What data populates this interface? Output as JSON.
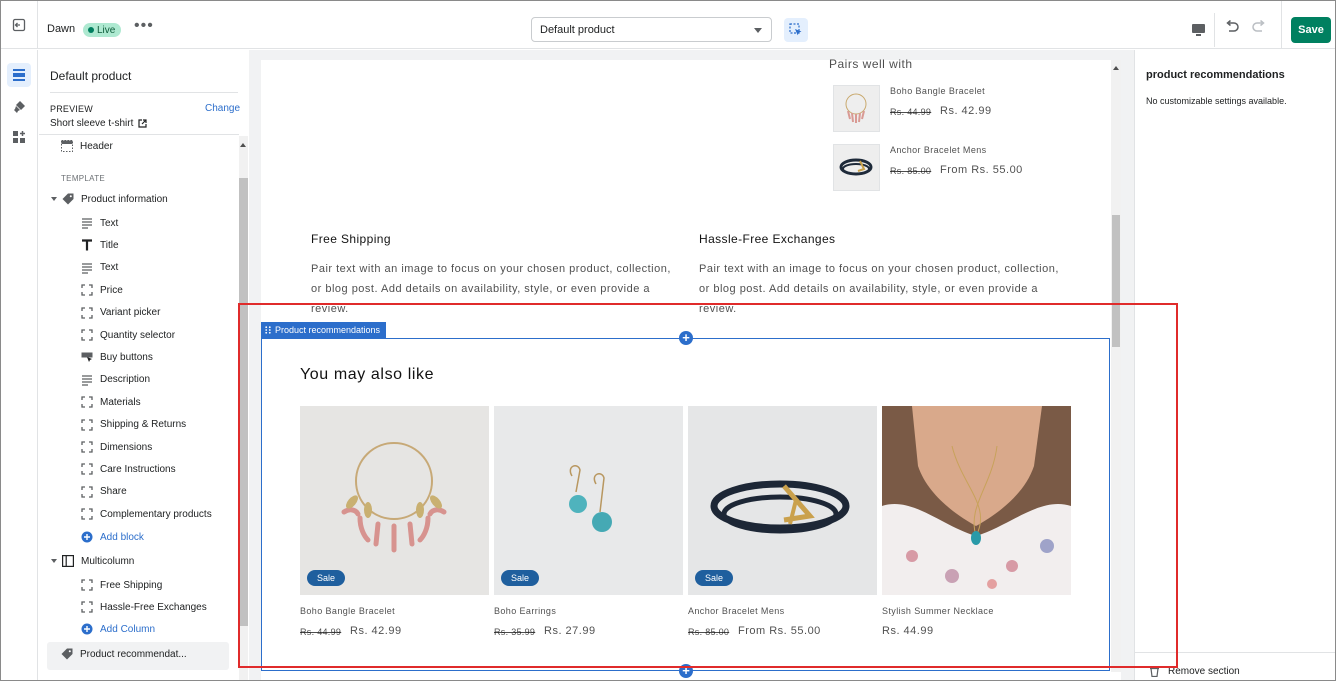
{
  "topbar": {
    "theme_name": "Dawn",
    "live_badge": "Live",
    "more_label": "•••",
    "template_select": "Default product",
    "save_label": "Save"
  },
  "sidebar": {
    "title": "Default product",
    "preview_label": "PREVIEW",
    "change_label": "Change",
    "preview_value": "Short sleeve t-shirt",
    "header_item": "Header",
    "template_label": "TEMPLATE",
    "product_info": "Product information",
    "blocks": [
      "Text",
      "Title",
      "Text",
      "Price",
      "Variant picker",
      "Quantity selector",
      "Buy buttons",
      "Description",
      "Materials",
      "Shipping & Returns",
      "Dimensions",
      "Care Instructions",
      "Share",
      "Complementary products"
    ],
    "block_icons": [
      "text-lines-icon",
      "title-t-icon",
      "text-lines-icon",
      "dashed-square-icon",
      "dashed-square-icon",
      "dashed-square-icon",
      "buy-buttons-icon",
      "text-lines-icon",
      "dashed-square-icon",
      "dashed-square-icon",
      "dashed-square-icon",
      "dashed-square-icon",
      "dashed-square-icon",
      "dashed-square-icon"
    ],
    "add_block": "Add block",
    "multicolumn": "Multicolumn",
    "columns": [
      "Free Shipping",
      "Hassle-Free Exchanges"
    ],
    "add_column": "Add Column",
    "product_recommendations": "Product recommendat..."
  },
  "preview": {
    "pairs_title": "Pairs well with",
    "pairs": [
      {
        "name": "Boho Bangle Bracelet",
        "old_price": "Rs. 44.99",
        "price": "Rs. 42.99"
      },
      {
        "name": "Anchor Bracelet Mens",
        "old_price": "Rs. 85.00",
        "price": "From Rs. 55.00"
      }
    ],
    "columns": [
      {
        "title": "Free Shipping",
        "text": "Pair text with an image to focus on your chosen product, collection, or blog post. Add details on availability, style, or even provide a review."
      },
      {
        "title": "Hassle-Free Exchanges",
        "text": "Pair text with an image to focus on your chosen product, collection, or blog post. Add details on availability, style, or even provide a review."
      }
    ],
    "section_tag": "Product recommendations",
    "heading": "You may also like",
    "sale_label": "Sale",
    "products": [
      {
        "name": "Boho Bangle Bracelet",
        "old_price": "Rs. 44.99",
        "price": "Rs. 42.99",
        "sale": true
      },
      {
        "name": "Boho Earrings",
        "old_price": "Rs. 35.99",
        "price": "Rs. 27.99",
        "sale": true
      },
      {
        "name": "Anchor Bracelet Mens",
        "old_price": "Rs. 85.00",
        "price": "From Rs. 55.00",
        "sale": true
      },
      {
        "name": "Stylish Summer Necklace",
        "old_price": "",
        "price": "Rs. 44.99",
        "sale": false
      }
    ]
  },
  "right_panel": {
    "title": "product recommendations",
    "message": "No customizable settings available.",
    "remove_section": "Remove section"
  },
  "colors": {
    "accent": "#2c6ecb",
    "save": "#008060",
    "highlight": "#e02b2b",
    "sale_badge": "#1f5f9e"
  }
}
